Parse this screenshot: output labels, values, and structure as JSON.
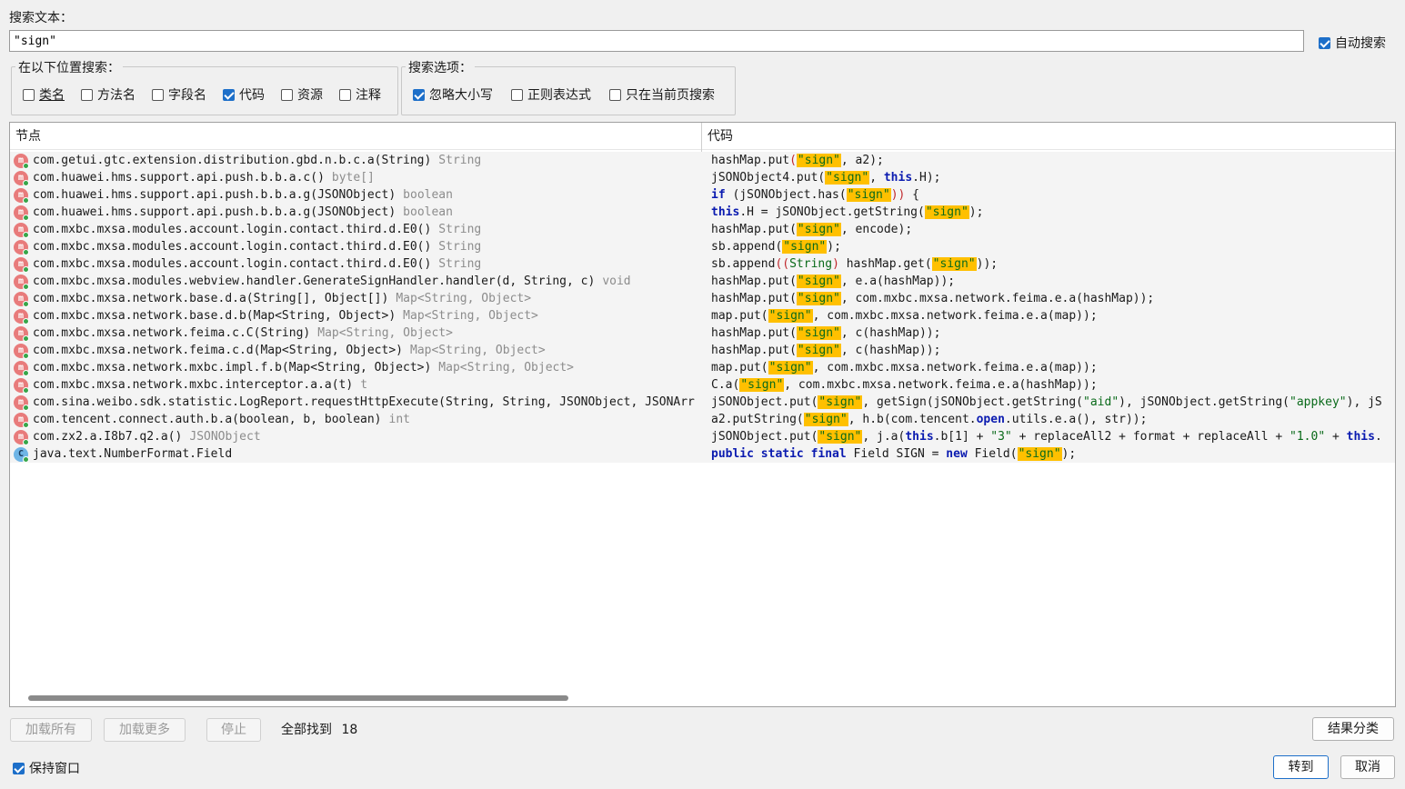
{
  "search": {
    "label": "搜索文本：",
    "value": "\"sign\"",
    "auto_search_label": "自动搜索",
    "auto_search_checked": true
  },
  "search_in": {
    "legend": "在以下位置搜索：",
    "options": [
      {
        "label": "类名",
        "checked": false
      },
      {
        "label": "方法名",
        "checked": false
      },
      {
        "label": "字段名",
        "checked": false
      },
      {
        "label": "代码",
        "checked": true
      },
      {
        "label": "资源",
        "checked": false
      },
      {
        "label": "注释",
        "checked": false
      }
    ]
  },
  "search_options": {
    "legend": "搜索选项：",
    "options": [
      {
        "label": "忽略大小写",
        "checked": true
      },
      {
        "label": "正则表达式",
        "checked": false
      },
      {
        "label": "只在当前页搜索",
        "checked": false
      }
    ]
  },
  "results": {
    "node_header": "节点",
    "code_header": "代码",
    "rows": [
      {
        "icon": "method-icon",
        "node": "com.getui.gtc.extension.distribution.gbd.n.b.c.a(String)",
        "ret": "String",
        "code": [
          [
            "t",
            "hashMap.put"
          ],
          [
            "p",
            "("
          ],
          [
            "h",
            "\"sign\""
          ],
          [
            "t",
            ", a2);"
          ]
        ]
      },
      {
        "icon": "method-icon",
        "node": "com.huawei.hms.support.api.push.b.b.a.c()",
        "ret": "byte[]",
        "code": [
          [
            "t",
            "jSONObject4.put("
          ],
          [
            "h",
            "\"sign\""
          ],
          [
            "t",
            ", "
          ],
          [
            "k",
            "this"
          ],
          [
            "t",
            ".H);"
          ]
        ]
      },
      {
        "icon": "method-icon",
        "node": "com.huawei.hms.support.api.push.b.b.a.g(JSONObject)",
        "ret": "boolean",
        "code": [
          [
            "k",
            "if"
          ],
          [
            "t",
            " (jSONObject.has("
          ],
          [
            "h",
            "\"sign\""
          ],
          [
            "p",
            "))"
          ],
          [
            "t",
            " {"
          ]
        ]
      },
      {
        "icon": "method-icon",
        "node": "com.huawei.hms.support.api.push.b.b.a.g(JSONObject)",
        "ret": "boolean",
        "code": [
          [
            "k",
            "this"
          ],
          [
            "t",
            ".H = jSONObject.getString("
          ],
          [
            "h",
            "\"sign\""
          ],
          [
            "t",
            ");"
          ]
        ]
      },
      {
        "icon": "method-icon",
        "node": "com.mxbc.mxsa.modules.account.login.contact.third.d.E0()",
        "ret": "String",
        "code": [
          [
            "t",
            "hashMap.put("
          ],
          [
            "h",
            "\"sign\""
          ],
          [
            "t",
            ", encode);"
          ]
        ]
      },
      {
        "icon": "method-icon",
        "node": "com.mxbc.mxsa.modules.account.login.contact.third.d.E0()",
        "ret": "String",
        "code": [
          [
            "t",
            "sb.append("
          ],
          [
            "h",
            "\"sign\""
          ],
          [
            "t",
            ");"
          ]
        ]
      },
      {
        "icon": "method-icon",
        "node": "com.mxbc.mxsa.modules.account.login.contact.third.d.E0()",
        "ret": "String",
        "code": [
          [
            "t",
            "sb.append"
          ],
          [
            "p",
            "(("
          ],
          [
            "s",
            "String"
          ],
          [
            "p",
            ")"
          ],
          [
            "t",
            " hashMap.get("
          ],
          [
            "h",
            "\"sign\""
          ],
          [
            "t",
            "));"
          ]
        ]
      },
      {
        "icon": "method-icon",
        "node": "com.mxbc.mxsa.modules.webview.handler.GenerateSignHandler.handler(d, String, c)",
        "ret": "void",
        "code": [
          [
            "t",
            "hashMap.put("
          ],
          [
            "h",
            "\"sign\""
          ],
          [
            "t",
            ", e.a(hashMap));"
          ]
        ]
      },
      {
        "icon": "method-icon",
        "node": "com.mxbc.mxsa.network.base.d.a(String[], Object[])",
        "ret": "Map<String, Object>",
        "code": [
          [
            "t",
            "hashMap.put("
          ],
          [
            "h",
            "\"sign\""
          ],
          [
            "t",
            ", com.mxbc.mxsa.network.feima.e.a(hashMap));"
          ]
        ]
      },
      {
        "icon": "method-icon",
        "node": "com.mxbc.mxsa.network.base.d.b(Map<String, Object>)",
        "ret": "Map<String, Object>",
        "code": [
          [
            "t",
            "map.put("
          ],
          [
            "h",
            "\"sign\""
          ],
          [
            "t",
            ", com.mxbc.mxsa.network.feima.e.a(map));"
          ]
        ]
      },
      {
        "icon": "method-icon",
        "node": "com.mxbc.mxsa.network.feima.c.C(String)",
        "ret": "Map<String, Object>",
        "code": [
          [
            "t",
            "hashMap.put("
          ],
          [
            "h",
            "\"sign\""
          ],
          [
            "t",
            ", c(hashMap));"
          ]
        ]
      },
      {
        "icon": "method-icon",
        "node": "com.mxbc.mxsa.network.feima.c.d(Map<String, Object>)",
        "ret": "Map<String, Object>",
        "code": [
          [
            "t",
            "hashMap.put("
          ],
          [
            "h",
            "\"sign\""
          ],
          [
            "t",
            ", c(hashMap));"
          ]
        ]
      },
      {
        "icon": "method-icon",
        "node": "com.mxbc.mxsa.network.mxbc.impl.f.b(Map<String, Object>)",
        "ret": "Map<String, Object>",
        "code": [
          [
            "t",
            "map.put("
          ],
          [
            "h",
            "\"sign\""
          ],
          [
            "t",
            ", com.mxbc.mxsa.network.feima.e.a(map));"
          ]
        ]
      },
      {
        "icon": "method-icon",
        "node": "com.mxbc.mxsa.network.mxbc.interceptor.a.a(t)",
        "ret": "t",
        "code": [
          [
            "t",
            "C.a("
          ],
          [
            "h",
            "\"sign\""
          ],
          [
            "t",
            ", com.mxbc.mxsa.network.feima.e.a(hashMap));"
          ]
        ]
      },
      {
        "icon": "method-icon",
        "node": "com.sina.weibo.sdk.statistic.LogReport.requestHttpExecute(String, String, JSONObject, JSONArr",
        "ret": "",
        "code": [
          [
            "t",
            "jSONObject.put("
          ],
          [
            "h",
            "\"sign\""
          ],
          [
            "t",
            ", getSign(jSONObject.getString("
          ],
          [
            "s",
            "\"aid\""
          ],
          [
            "t",
            "), jSONObject.getString("
          ],
          [
            "s",
            "\"appkey\""
          ],
          [
            "t",
            "), jS"
          ]
        ]
      },
      {
        "icon": "method-icon",
        "node": "com.tencent.connect.auth.b.a(boolean, b, boolean)",
        "ret": "int",
        "code": [
          [
            "t",
            "a2.putString("
          ],
          [
            "h",
            "\"sign\""
          ],
          [
            "t",
            ", h.b(com.tencent."
          ],
          [
            "k",
            "open"
          ],
          [
            "t",
            ".utils.e.a(), str));"
          ]
        ]
      },
      {
        "icon": "method-icon",
        "node": "com.zx2.a.I8b7.q2.a()",
        "ret": "JSONObject",
        "code": [
          [
            "t",
            "jSONObject.put("
          ],
          [
            "h",
            "\"sign\""
          ],
          [
            "t",
            ", j.a("
          ],
          [
            "k",
            "this"
          ],
          [
            "t",
            ".b[1] + "
          ],
          [
            "s",
            "\"3\""
          ],
          [
            "t",
            " + replaceAll2 + format + replaceAll + "
          ],
          [
            "s",
            "\"1.0\""
          ],
          [
            "t",
            " + "
          ],
          [
            "k",
            "this"
          ],
          [
            "t",
            "."
          ]
        ]
      },
      {
        "icon": "class-icon",
        "node": "java.text.NumberFormat.Field",
        "ret": "",
        "code": [
          [
            "k",
            "public static final"
          ],
          [
            "t",
            " Field SIGN = "
          ],
          [
            "k",
            "new"
          ],
          [
            "t",
            " Field("
          ],
          [
            "h",
            "\"sign\""
          ],
          [
            "t",
            ");"
          ]
        ]
      }
    ]
  },
  "footer": {
    "load_all": "加载所有",
    "load_more": "加载更多",
    "stop": "停止",
    "found_label": "全部找到",
    "found_count": "18",
    "group_results": "结果分类",
    "keep_window": "保持窗口",
    "keep_window_checked": true,
    "goto": "转到",
    "cancel": "取消"
  }
}
